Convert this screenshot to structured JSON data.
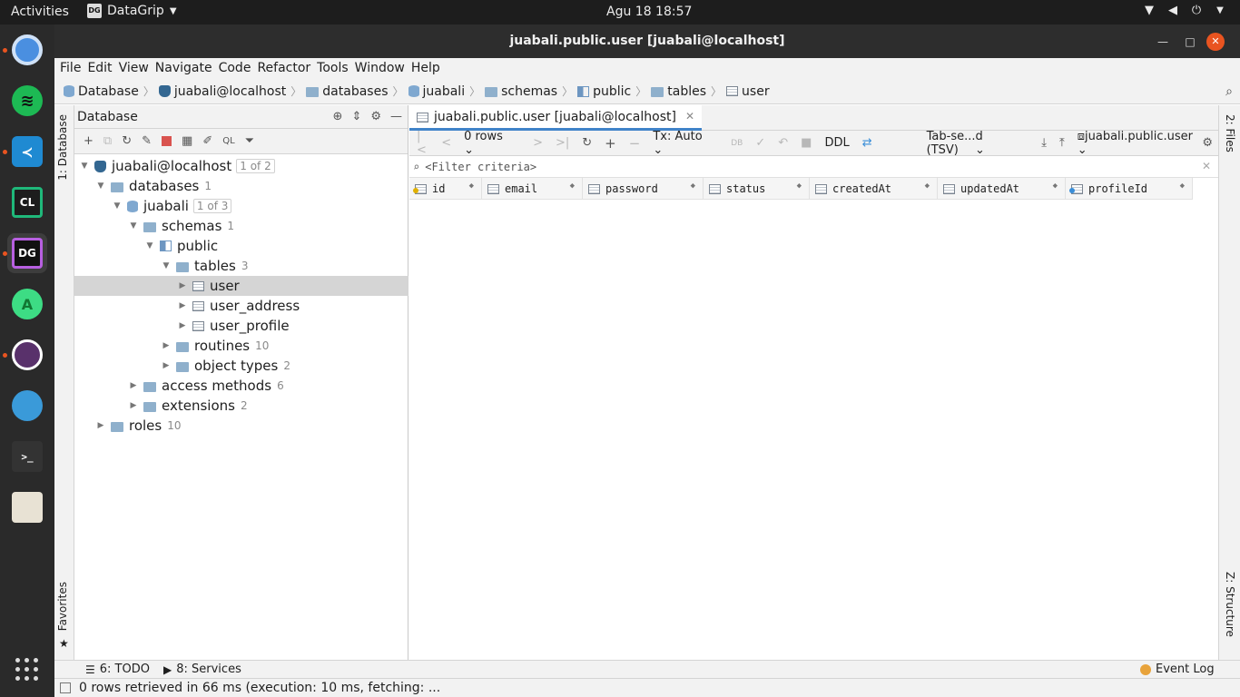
{
  "topbar": {
    "activities": "Activities",
    "app_name": "DataGrip",
    "clock": "Agu 18  18:57"
  },
  "window": {
    "title": "juabali.public.user [juabali@localhost]"
  },
  "menu": [
    "File",
    "Edit",
    "View",
    "Navigate",
    "Code",
    "Refactor",
    "Tools",
    "Window",
    "Help"
  ],
  "breadcrumb": [
    "Database",
    "juabali@localhost",
    "databases",
    "juabali",
    "schemas",
    "public",
    "tables",
    "user"
  ],
  "side_tabs": {
    "database": "1: Database",
    "favorites": "Favorites",
    "files": "2: Files",
    "structure": "Z: Structure"
  },
  "db_panel": {
    "title": "Database",
    "tree": [
      {
        "label": "juabali@localhost",
        "badge": "1 of 2",
        "count": ""
      },
      {
        "label": "databases",
        "badge": "",
        "count": "1"
      },
      {
        "label": "juabali",
        "badge": "1 of 3",
        "count": ""
      },
      {
        "label": "schemas",
        "badge": "",
        "count": "1"
      },
      {
        "label": "public",
        "badge": "",
        "count": ""
      },
      {
        "label": "tables",
        "badge": "",
        "count": "3"
      },
      {
        "label": "user",
        "badge": "",
        "count": ""
      },
      {
        "label": "user_address",
        "badge": "",
        "count": ""
      },
      {
        "label": "user_profile",
        "badge": "",
        "count": ""
      },
      {
        "label": "routines",
        "badge": "",
        "count": "10"
      },
      {
        "label": "object types",
        "badge": "",
        "count": "2"
      },
      {
        "label": "access methods",
        "badge": "",
        "count": "6"
      },
      {
        "label": "extensions",
        "badge": "",
        "count": "2"
      },
      {
        "label": "roles",
        "badge": "",
        "count": "10"
      }
    ]
  },
  "editor": {
    "tab_label": "juabali.public.user [juabali@localhost]",
    "rows_label": "0 rows",
    "tx_label": "Tx: Auto",
    "ddl_label": "DDL",
    "export_format": "Tab-se...d (TSV)",
    "target_label": "juabali.public.user",
    "filter_placeholder": "<Filter criteria>",
    "columns": [
      "id",
      "email",
      "password",
      "status",
      "createdAt",
      "updatedAt",
      "profileId"
    ]
  },
  "bottom": {
    "todo": "6: TODO",
    "services": "8: Services",
    "event_log": "Event Log",
    "status_message": "0 rows retrieved in 66 ms (execution: 10 ms, fetching: ..."
  }
}
